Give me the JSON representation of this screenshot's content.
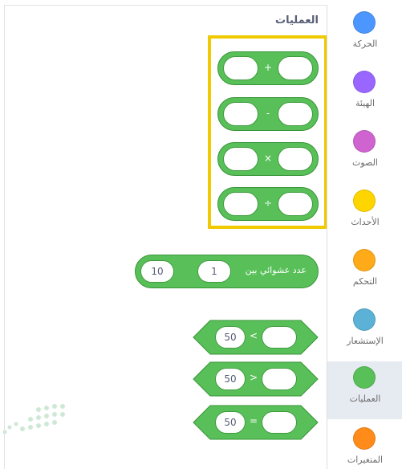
{
  "palette": {
    "title": "العمليات"
  },
  "sidebar": {
    "items": [
      {
        "label": "الحركة",
        "color": "#4c97ff",
        "selected": false
      },
      {
        "label": "الهيئة",
        "color": "#9966ff",
        "selected": false
      },
      {
        "label": "الصوت",
        "color": "#cf63cf",
        "selected": false
      },
      {
        "label": "الأحداث",
        "color": "#ffd500",
        "selected": false
      },
      {
        "label": "التحكم",
        "color": "#ffab19",
        "selected": false
      },
      {
        "label": "الإستشعار",
        "color": "#5cb1d6",
        "selected": false
      },
      {
        "label": "العمليات",
        "color": "#59c059",
        "selected": true
      },
      {
        "label": "المتغيرات",
        "color": "#ff8c1a",
        "selected": false
      }
    ]
  },
  "blocks": {
    "arithmetic": [
      {
        "sign": "+",
        "left": "",
        "right": ""
      },
      {
        "sign": "-",
        "left": "",
        "right": ""
      },
      {
        "sign": "×",
        "left": "",
        "right": ""
      },
      {
        "sign": "÷",
        "left": "",
        "right": ""
      }
    ],
    "random": {
      "label": "عدد عشوائي بين",
      "and": "و",
      "from": "1",
      "to": "10"
    },
    "comparisons": [
      {
        "sign": "<",
        "left": "50",
        "right": ""
      },
      {
        "sign": ">",
        "left": "50",
        "right": ""
      },
      {
        "sign": "=",
        "left": "50",
        "right": ""
      }
    ]
  },
  "colors": {
    "operators": "#59c059",
    "operators_border": "#389438",
    "highlight": "#f0c900",
    "selected_bg": "#e6ebf2"
  }
}
